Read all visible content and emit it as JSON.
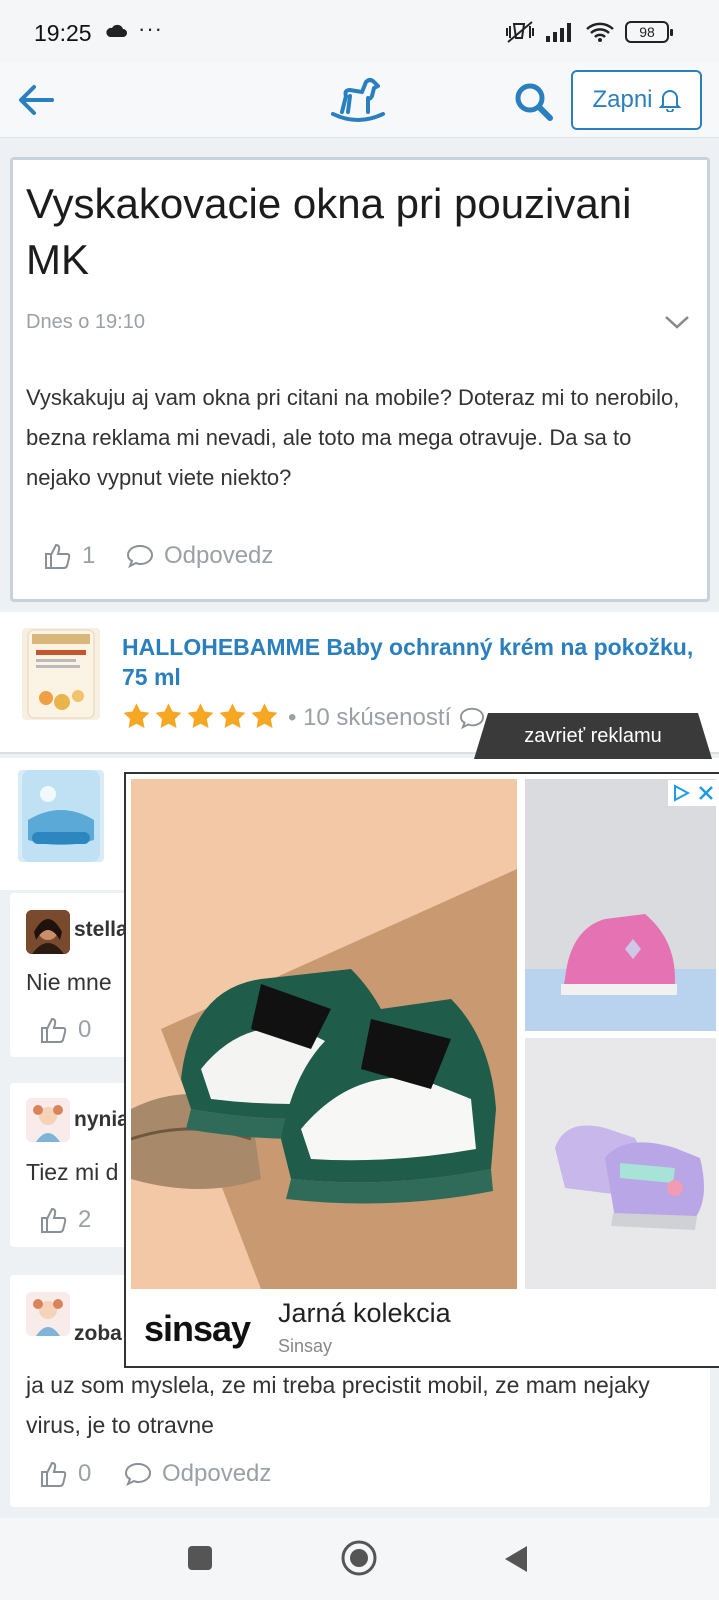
{
  "status_bar": {
    "time": "19:25",
    "dots": "···",
    "battery": "98"
  },
  "nav": {
    "zapni_label": "Zapni"
  },
  "post": {
    "title": "Vyskakovacie okna pri pouzivani MK",
    "date": "Dnes o 19:10",
    "body": "Vyskakuju aj vam okna pri citani na mobile? Doteraz mi to nerobilo, bezna reklama mi nevadi, ale toto ma mega otravuje. Da sa to nejako vypnut viete niekto?",
    "likes": "1",
    "reply_label": "Odpovedz"
  },
  "product": {
    "title": "HALLOHEBAMME Baby ochranný krém na pokožku, 75 ml",
    "rating": 5,
    "reviews": "• 10 skúseností"
  },
  "comments": [
    {
      "name": "stella",
      "text": "Nie mne",
      "likes": "0"
    },
    {
      "name": "nynia",
      "text": "Tiez mi d",
      "likes": "2"
    },
    {
      "name": "zoba",
      "text": "ja uz som myslela, ze mi treba precistit mobil, ze mam nejaky virus, je to otravne",
      "likes": "0",
      "reply_label": "Odpovedz"
    }
  ],
  "ad": {
    "close_label": "zavrieť reklamu",
    "brand": "sinsay",
    "headline": "Jarná kolekcia",
    "advertiser": "Sinsay"
  },
  "colors": {
    "accent": "#2a7fbf",
    "star": "#f5a623",
    "ad_tab": "#3a3a3a"
  }
}
